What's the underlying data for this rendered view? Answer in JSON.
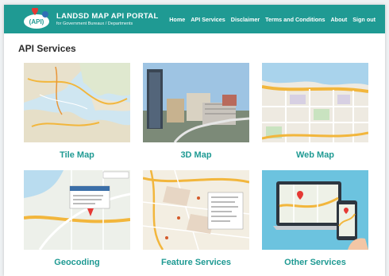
{
  "header": {
    "logo_text": "API",
    "title": "LANDSD MAP API PORTAL",
    "subtitle": "for Government Bureaux / Departments",
    "nav": [
      "Home",
      "API Services",
      "Disclaimer",
      "Terms and Conditions",
      "About",
      "Sign out"
    ]
  },
  "page": {
    "title": "API Services"
  },
  "services": [
    {
      "label": "Tile Map"
    },
    {
      "label": "3D Map"
    },
    {
      "label": "Web Map"
    },
    {
      "label": "Geocoding"
    },
    {
      "label": "Feature Services"
    },
    {
      "label": "Other Services"
    }
  ],
  "colors": {
    "header": "#1f9a93",
    "accent": "#1f9a93"
  }
}
